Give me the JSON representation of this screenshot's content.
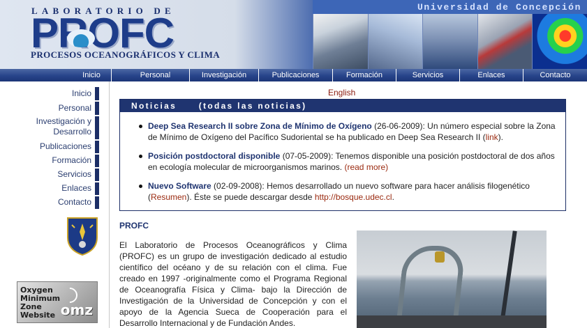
{
  "header": {
    "lab_label": "LABORATORIO DE",
    "brand": "PROFC",
    "subtitle": "PROCESOS OCEANOGRÁFICOS Y CLIMA",
    "university": "Universidad de Concepción",
    "colors": {
      "brand_blue": "#1e3d8a",
      "nav_blue": "#27448a"
    }
  },
  "topnav": {
    "items": [
      {
        "label": "Inicio"
      },
      {
        "label": "Personal"
      },
      {
        "label": "Investigación"
      },
      {
        "label": "Publicaciones"
      },
      {
        "label": "Formación"
      },
      {
        "label": "Servicios"
      },
      {
        "label": "Enlaces"
      },
      {
        "label": "Contacto"
      }
    ]
  },
  "sidebar": {
    "items": [
      {
        "label": "Inicio"
      },
      {
        "label": "Personal"
      },
      {
        "label": "Investigación y",
        "label2": "Desarrollo"
      },
      {
        "label": "Publicaciones"
      },
      {
        "label": "Formación"
      },
      {
        "label": "Servicios"
      },
      {
        "label": "Enlaces"
      },
      {
        "label": "Contacto"
      }
    ],
    "omz_logo": {
      "line1": "Oxygen",
      "line2": "Minimum",
      "line3": "Zone",
      "line4": "Website",
      "mark": "omz"
    }
  },
  "main": {
    "language_link": "English",
    "news": {
      "header": "Noticias",
      "all_link": "(todas las noticias)",
      "items": [
        {
          "title": "Deep Sea Research II sobre Zona de Mínimo de Oxígeno",
          "date": " (26-06-2009): ",
          "body": "Un número especial sobre la Zona de Mínimo de Oxígeno del Pacífico Sudoriental se ha publicado en Deep Sea Research II (",
          "link": "link",
          "after": ")."
        },
        {
          "title": "Posición postdoctoral disponible",
          "date": " (07-05-2009): ",
          "body": "Tenemos disponible una posición postdoctoral de dos años en ecología molecular de microorganismos marinos. ",
          "link": "(read more)",
          "after": ""
        },
        {
          "title": "Nuevo Software",
          "date": " (02-09-2008): ",
          "body": "Hemos desarrollado un nuevo software para hacer análisis filogenético (",
          "link": "Resumen",
          "after": "). Éste se puede descargar desde ",
          "link2": "http://bosque.udec.cl",
          "after2": "."
        }
      ]
    },
    "profc": {
      "title": "PROFC",
      "text": "El Laboratorio de Procesos Oceanográficos y Clima (PROFC) es un grupo de investigación dedicado al estudio científico del océano y de su relación con el clima. Fue creado en 1997 -originalmente como el Programa Regional de Oceanografía Física y Clima- bajo la Dirección de Investigación de la Universidad de Concepción y con el apoyo de la Agencia Sueca de Cooperación para el Desarrollo Internacional y de Fundación Andes."
    }
  }
}
